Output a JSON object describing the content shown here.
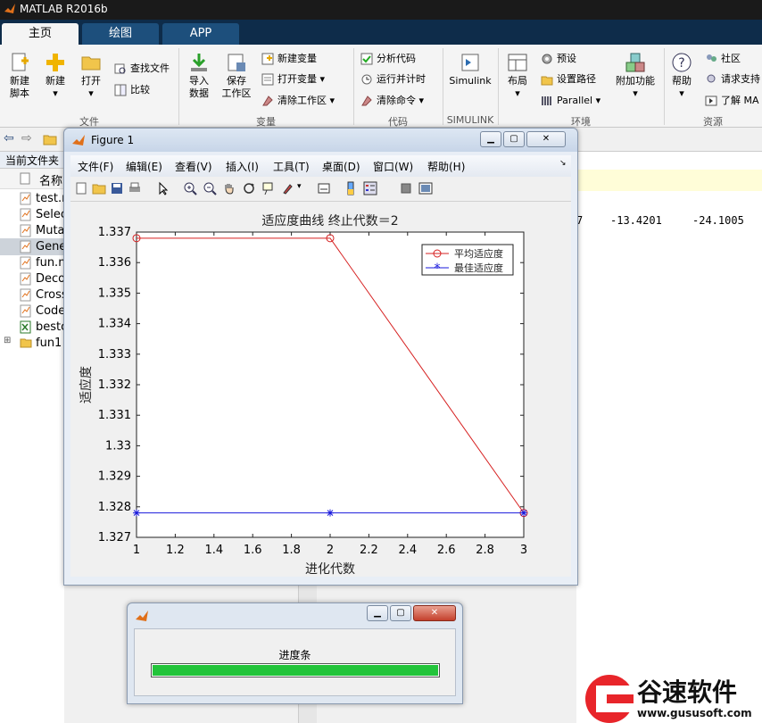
{
  "app": {
    "title": "MATLAB R2016b"
  },
  "tabs": [
    {
      "label": "主页"
    },
    {
      "label": "绘图"
    },
    {
      "label": "APP"
    }
  ],
  "ribbon": {
    "new_script": "新建\n脚本",
    "new_script_l1": "新建",
    "new_script_l2": "脚本",
    "new": "新建",
    "open": "打开",
    "find_files": "查找文件",
    "compare": "比较",
    "import_l1": "导入",
    "import_l2": "数据",
    "save_l1": "保存",
    "save_l2": "工作区",
    "new_var": "新建变量",
    "open_var": "打开变量",
    "clear_ws": "清除工作区",
    "analyze_code": "分析代码",
    "run_time": "运行并计时",
    "clear_cmd": "清除命令",
    "simulink": "Simulink",
    "layout": "布局",
    "prefs": "预设",
    "set_path": "设置路径",
    "parallel": "Parallel",
    "addons": "附加功能",
    "help": "帮助",
    "community": "社区",
    "request_support": "请求支持",
    "learn_matlab": "了解 MA",
    "groups": {
      "file": "文件",
      "variable": "变量",
      "code": "代码",
      "simulink": "SIMULINK",
      "env": "环境",
      "resources": "资源"
    }
  },
  "left_panel": {
    "header": "当前文件夹",
    "col_name": "名称",
    "files": [
      {
        "name": "test.m"
      },
      {
        "name": "Selec"
      },
      {
        "name": "Muta"
      },
      {
        "name": "Gene"
      },
      {
        "name": "fun.m"
      },
      {
        "name": "Deco"
      },
      {
        "name": "Cross"
      },
      {
        "name": "Code"
      },
      {
        "name": "bestc"
      },
      {
        "name": "fun1"
      }
    ]
  },
  "cmd_window": {
    "values": [
      "7",
      "-13.4201",
      "-24.1005"
    ]
  },
  "figure": {
    "title": "Figure 1",
    "menus": [
      "文件(F)",
      "编辑(E)",
      "查看(V)",
      "插入(I)",
      "工具(T)",
      "桌面(D)",
      "窗口(W)",
      "帮助(H)"
    ]
  },
  "chart_data": {
    "type": "line",
    "title": "适应度曲线  终止代数＝2",
    "xlabel": "进化代数",
    "ylabel": "适应度",
    "xlim": [
      1,
      3
    ],
    "ylim": [
      1.327,
      1.337
    ],
    "xticks": [
      "1",
      "1.2",
      "1.4",
      "1.6",
      "1.8",
      "2",
      "2.2",
      "2.4",
      "2.6",
      "2.8",
      "3"
    ],
    "yticks": [
      "1.327",
      "1.328",
      "1.329",
      "1.33",
      "1.331",
      "1.332",
      "1.333",
      "1.334",
      "1.335",
      "1.336",
      "1.337"
    ],
    "legend_position": "top-right",
    "grid": false,
    "series": [
      {
        "name": "平均适应度",
        "color": "#d62020",
        "marker": "circle",
        "x": [
          1,
          2,
          3
        ],
        "y": [
          1.3368,
          1.3368,
          1.3278
        ]
      },
      {
        "name": "最佳适应度",
        "color": "#1a1adc",
        "marker": "star",
        "x": [
          1,
          2,
          3
        ],
        "y": [
          1.3278,
          1.3278,
          1.3278
        ]
      }
    ]
  },
  "progress": {
    "label": "进度条",
    "value": 1.0,
    "bar_color": "#22c43a"
  },
  "watermark": {
    "brand": "谷速软件",
    "url": "www.gususoft.com"
  }
}
